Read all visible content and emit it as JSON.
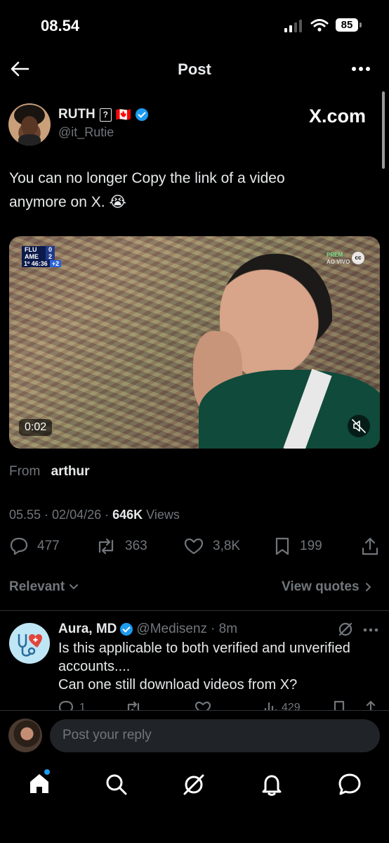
{
  "status_bar": {
    "time": "08.54",
    "battery": "85"
  },
  "header": {
    "title": "Post"
  },
  "post": {
    "author_name": "RUTH",
    "author_emoji": "🇨🇦",
    "handle": "@it_Rutie",
    "brand": "X.com",
    "text": "You can no longer Copy the link of a video anymore on X. 😭",
    "video": {
      "duration": "0:02",
      "score_team1": "FLU",
      "score_team1_goals": "0",
      "score_team2": "AME",
      "score_team2_goals": "2",
      "match_clock": "1º 46:36",
      "added_time": "+2",
      "channel": "PREM",
      "channel_sub": "AO VIVO"
    },
    "from_label": "From",
    "from_user": "arthur",
    "meta_time": "05.55 · 02/04/26 ·",
    "views_count": "646K",
    "views_label": "Views",
    "replies": "477",
    "reposts": "363",
    "likes": "3,8K",
    "bookmarks": "199"
  },
  "filter": {
    "sort_label": "Relevant",
    "view_quotes": "View quotes"
  },
  "reply": {
    "name": "Aura, MD",
    "handle": "@Medisenz",
    "time": "· 8m",
    "text_line1": "Is this applicable to both verified and unverified",
    "text_line2": "accounts....",
    "text_line3": "Can one still download videos from X?",
    "replies": "1",
    "views": "429"
  },
  "composer": {
    "placeholder": "Post your reply"
  }
}
